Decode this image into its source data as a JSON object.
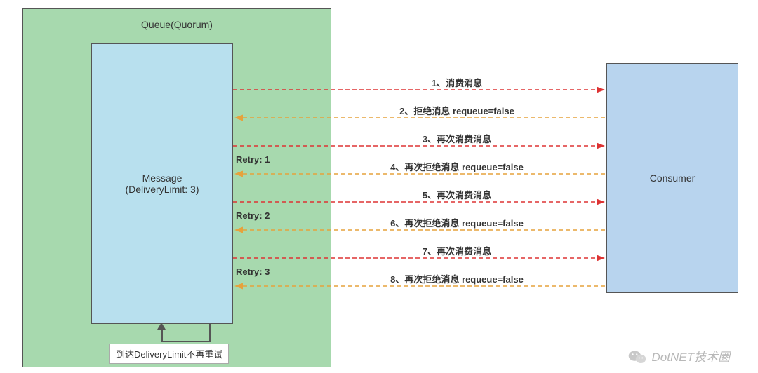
{
  "queue": {
    "title": "Queue(Quorum)"
  },
  "message": {
    "line1": "Message",
    "line2": "(DeliveryLimit: 3)"
  },
  "retry": {
    "r1": "Retry: 1",
    "r2": "Retry: 2",
    "r3": "Retry: 3"
  },
  "drop": {
    "note": "到达DeliveryLimit不再重试"
  },
  "consumer": {
    "label": "Consumer"
  },
  "flows": {
    "f1": "1、消费消息",
    "f2": "2、拒绝消息 requeue=false",
    "f3": "3、再次消费消息",
    "f4": "4、再次拒绝消息 requeue=false",
    "f5": "5、再次消费消息",
    "f6": "6、再次拒绝消息 requeue=false",
    "f7": "7、再次消费消息",
    "f8": "8、再次拒绝消息 requeue=false"
  },
  "watermark": {
    "text": "DotNET技术圈"
  }
}
